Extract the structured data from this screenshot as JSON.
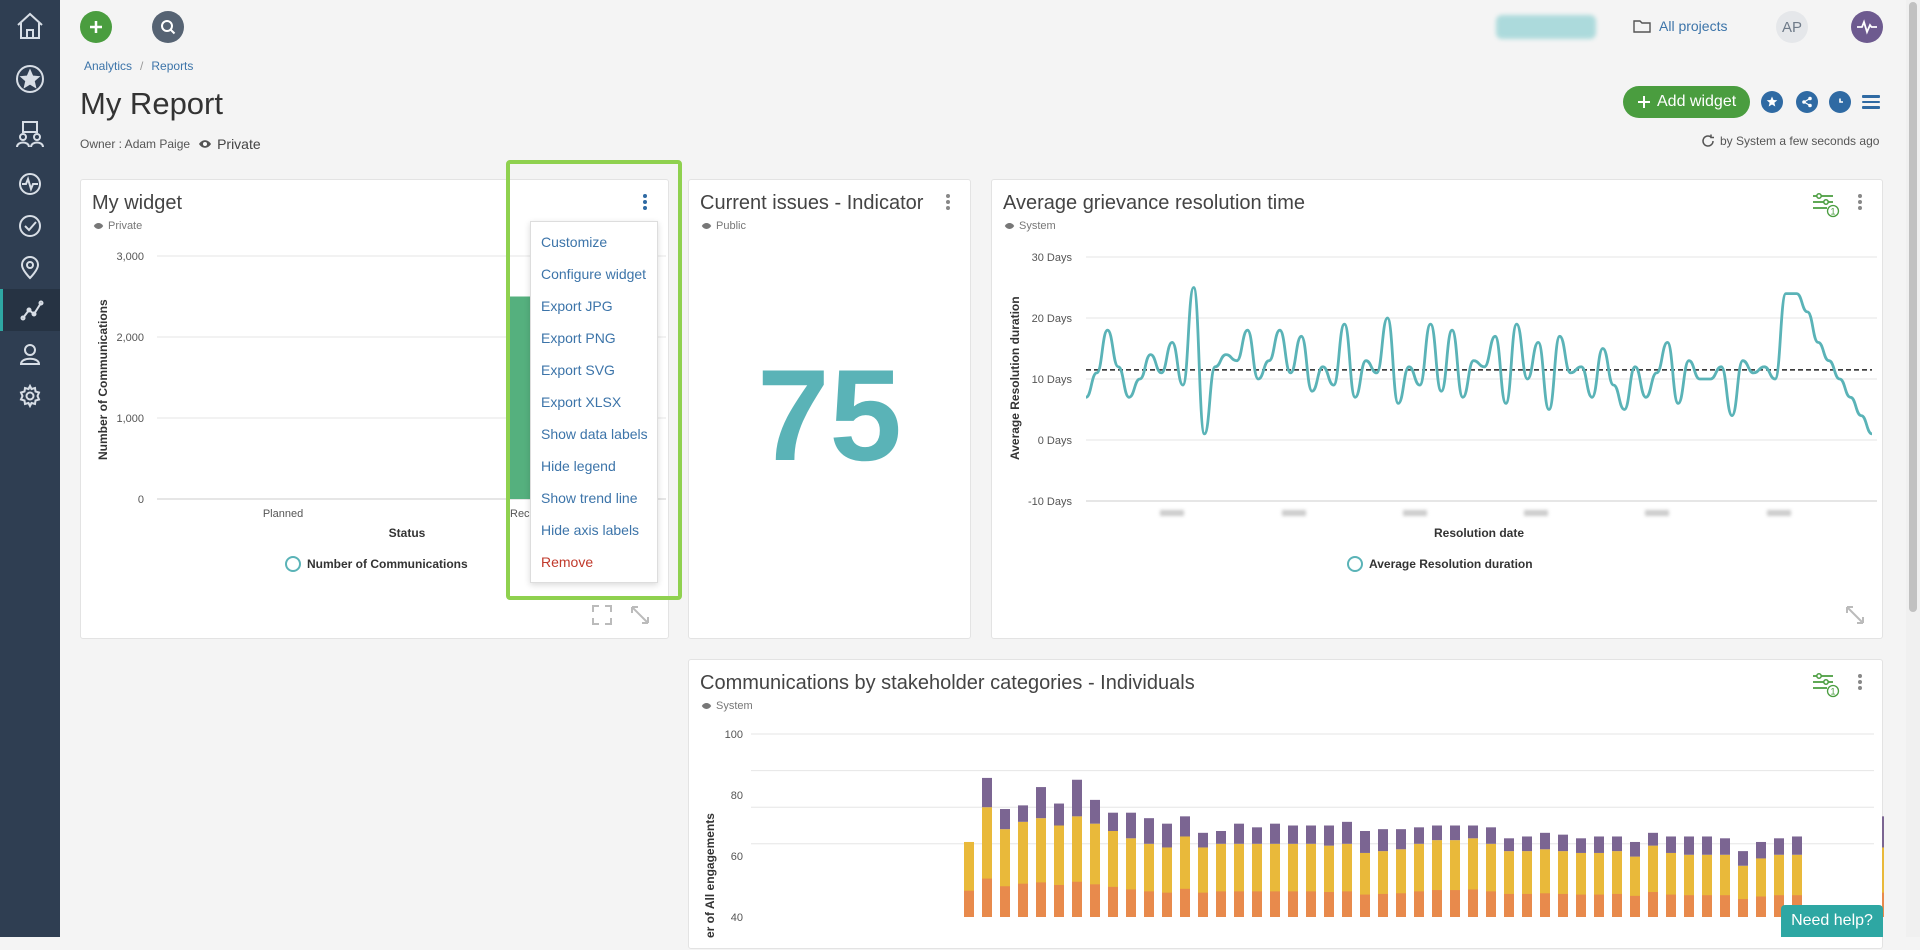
{
  "topbar": {
    "projects_label": "All projects",
    "avatar_initials": "AP"
  },
  "breadcrumb": [
    "Analytics",
    "Reports"
  ],
  "page": {
    "title": "My Report",
    "owner_label": "Owner : Adam Paige",
    "visibility": "Private",
    "add_widget_label": "Add widget",
    "refresh_text": "by System a few seconds ago"
  },
  "widgets": {
    "my_widget": {
      "title": "My widget",
      "visibility": "Private",
      "menu": [
        "Customize",
        "Configure widget",
        "Export JPG",
        "Export PNG",
        "Export SVG",
        "Export XLSX",
        "Show data labels",
        "Hide legend",
        "Show trend line",
        "Hide axis labels"
      ],
      "menu_remove": "Remove"
    },
    "indicator": {
      "title": "Current issues - Indicator",
      "visibility": "Public",
      "value": "75"
    },
    "grievance": {
      "title": "Average grievance resolution time",
      "visibility": "System",
      "filter_count": "1"
    },
    "stakeholders": {
      "title": "Communications by stakeholder categories - Individuals",
      "visibility": "System",
      "filter_count": "1"
    }
  },
  "help_label": "Need help?",
  "colors": {
    "accent_green": "#4a9d3f",
    "teal": "#5ab3b7",
    "link_blue": "#3c74a9",
    "highlight": "#8fd14f",
    "sidebar": "#2f3e52"
  },
  "chart_data": [
    {
      "type": "bar",
      "categories": [
        "Planned",
        "Reco"
      ],
      "series": [
        {
          "name": "Number of Communications",
          "values": [
            0,
            2500
          ]
        }
      ],
      "xlabel": "Status",
      "ylabel": "Number of Communications",
      "yticks": [
        "0",
        "1,000",
        "2,000",
        "3,000"
      ],
      "ylim": [
        0,
        3000
      ],
      "legend": "bottom"
    },
    {
      "type": "line",
      "series": [
        {
          "name": "Average Resolution duration",
          "values": [
            7,
            11,
            18,
            12,
            7,
            10,
            14,
            11,
            16,
            9,
            25,
            1,
            12,
            14,
            13,
            18,
            10,
            13,
            18,
            11,
            17,
            8,
            12,
            9,
            19,
            7,
            13,
            11,
            20,
            6,
            12,
            9,
            19,
            8,
            18,
            7,
            13,
            12,
            17,
            6,
            19,
            10,
            16,
            5,
            17,
            11,
            12,
            7,
            15,
            9,
            5,
            12,
            7,
            11,
            16,
            6,
            13,
            10,
            10,
            12,
            4,
            13,
            11,
            12,
            10,
            24,
            24,
            21,
            16,
            13,
            10,
            7,
            4,
            1
          ],
          "trend": 11.5
        }
      ],
      "xlabel": "Resolution date",
      "ylabel": "Average Resolution duration",
      "yticks": [
        "-10 Days",
        "0 Days",
        "10 Days",
        "20 Days",
        "30 Days"
      ],
      "ylim": [
        -10,
        30
      ],
      "legend": "bottom"
    },
    {
      "type": "bar",
      "stacked": true,
      "ylabel": "er of All engagements",
      "yticks": [
        "40",
        "60",
        "80",
        "100"
      ],
      "ylim": [
        0,
        100
      ],
      "series": [
        {
          "values": [
            0,
            0,
            0,
            0,
            0,
            0,
            0,
            0,
            0,
            0,
            41,
            60,
            48,
            52,
            54,
            50,
            55,
            51,
            47,
            43,
            40,
            38,
            44,
            38,
            40,
            40,
            40,
            40,
            40,
            40,
            39,
            40,
            35,
            36,
            37,
            40,
            42,
            42,
            43,
            40,
            36,
            36,
            37,
            36,
            35,
            35,
            36,
            33,
            39,
            35,
            34,
            34,
            34,
            28,
            32,
            34,
            34,
            0,
            0,
            0,
            0,
            38,
            0
          ]
        },
        {
          "values": [
            0,
            0,
            0,
            0,
            0,
            0,
            0,
            0,
            0,
            0,
            0,
            16,
            11,
            9,
            17,
            12,
            20,
            13,
            10,
            14,
            14,
            13,
            11,
            8,
            7,
            11,
            9,
            11,
            10,
            10,
            11,
            12,
            12,
            12,
            11,
            9,
            8,
            8,
            7,
            9,
            7,
            8,
            9,
            9,
            8,
            9,
            8,
            8,
            7,
            9,
            10,
            10,
            9,
            8,
            9,
            9,
            10,
            0,
            0,
            0,
            0,
            17,
            0
          ]
        }
      ],
      "colors": [
        "#e9b93a",
        "#7b6592"
      ]
    }
  ]
}
